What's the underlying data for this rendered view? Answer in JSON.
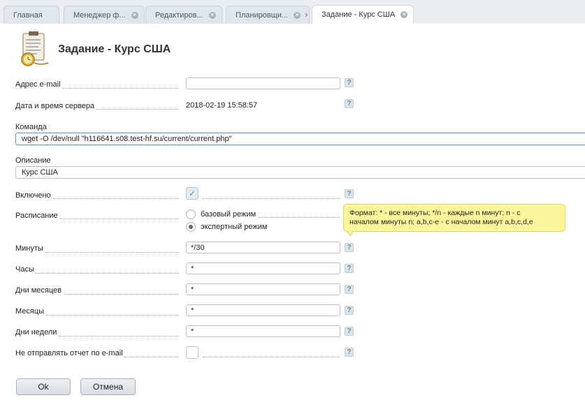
{
  "tabs": [
    {
      "label": "Главная",
      "closable": false
    },
    {
      "label": "Менеджер ф...",
      "closable": true
    },
    {
      "label": "Редактиров...",
      "closable": true
    },
    {
      "label": "Планировщи...",
      "closable": true
    },
    {
      "label": "Задание - Курс США",
      "closable": true,
      "active": true
    }
  ],
  "page_title": "Задание - Курс США",
  "fields": {
    "email": {
      "label": "Адрес e-mail",
      "value": ""
    },
    "server_time": {
      "label": "Дата и время сервера",
      "value": "2018-02-19 15:58:57"
    },
    "command": {
      "label": "Команда",
      "value": "wget -O /dev/null \"h116641.s08.test-hf.su/current/current.php\""
    },
    "description": {
      "label": "Описание",
      "value": "Курс США"
    },
    "enabled": {
      "label": "Включено",
      "checked": true
    },
    "schedule": {
      "label": "Расписание",
      "options": [
        "базовый режим",
        "экспертный режим"
      ],
      "selected": "экспертный режим"
    },
    "minutes": {
      "label": "Минуты",
      "value": "*/30"
    },
    "hours": {
      "label": "Часы",
      "value": "*"
    },
    "days_of_month": {
      "label": "Дни месяцев",
      "value": "*"
    },
    "months": {
      "label": "Месяцы",
      "value": "*"
    },
    "days_of_week": {
      "label": "Дни недели",
      "value": "*"
    },
    "no_email_report": {
      "label": "Не отправлять отчет по e-mail",
      "checked": false
    }
  },
  "help_glyph": "?",
  "tooltip": {
    "line1": "Формат: * - все минуты; */n - каждые n минут; n - с",
    "line2": "началом минуты n; a,b,c-e - с началом минут a,b,c,d,e"
  },
  "buttons": {
    "ok": "Ok",
    "cancel": "Отмена"
  },
  "colors": {
    "tooltip_bg": "#fdf59b",
    "input_focus": "#6b9bd2",
    "tab_bar": "#eaeef1"
  },
  "icons": {
    "logo": "clipboard-clock-icon",
    "close": "close-icon",
    "separator": "chevron-right-icon",
    "help": "help-icon",
    "check": "checkmark-icon"
  }
}
